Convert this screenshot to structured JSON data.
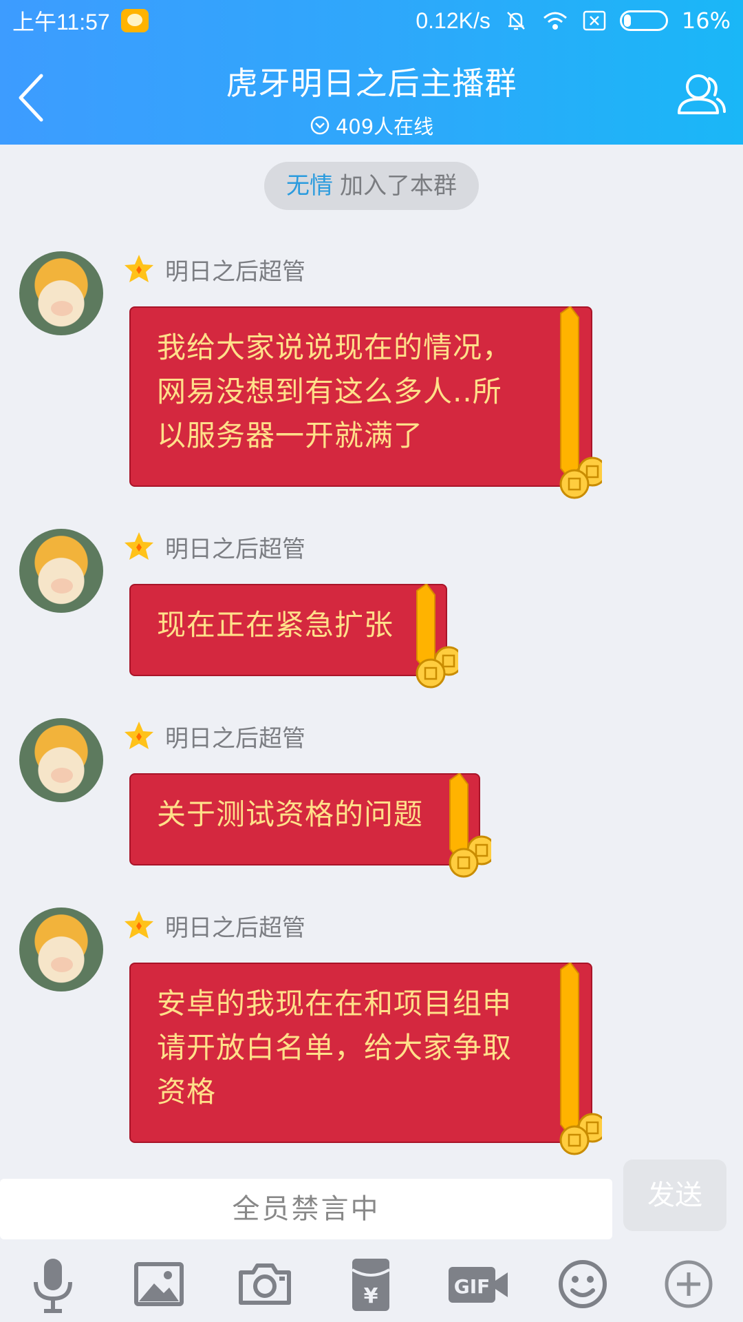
{
  "status_bar": {
    "time": "上午11:57",
    "net_speed": "0.12K/s",
    "battery": "16%"
  },
  "header": {
    "title": "虎牙明日之后主播群",
    "online": "409人在线"
  },
  "system_notice": {
    "name": "无情",
    "text": "加入了本群"
  },
  "messages": [
    {
      "sender": "明日之后超管",
      "text": "我给大家说说现在的情况，\n网易没想到有这么多人..所\n以服务器一开就满了"
    },
    {
      "sender": "明日之后超管",
      "text": "现在正在紧急扩张"
    },
    {
      "sender": "明日之后超管",
      "text": "关于测试资格的问题"
    },
    {
      "sender": "明日之后超管",
      "text": "安卓的我现在在和项目组申\n请开放白名单，给大家争取\n资格"
    }
  ],
  "input": {
    "placeholder": "全员禁言中",
    "send_label": "发送"
  },
  "toolbar_icons": [
    "microphone-icon",
    "image-icon",
    "camera-icon",
    "red-packet-icon",
    "gif-icon",
    "emoji-icon",
    "plus-icon"
  ],
  "colors": {
    "header_start": "#3d9cff",
    "header_end": "#1ab7f7",
    "bubble_bg": "#d4283f",
    "bubble_text": "#ffe08a",
    "join_name": "#2a9bde"
  }
}
